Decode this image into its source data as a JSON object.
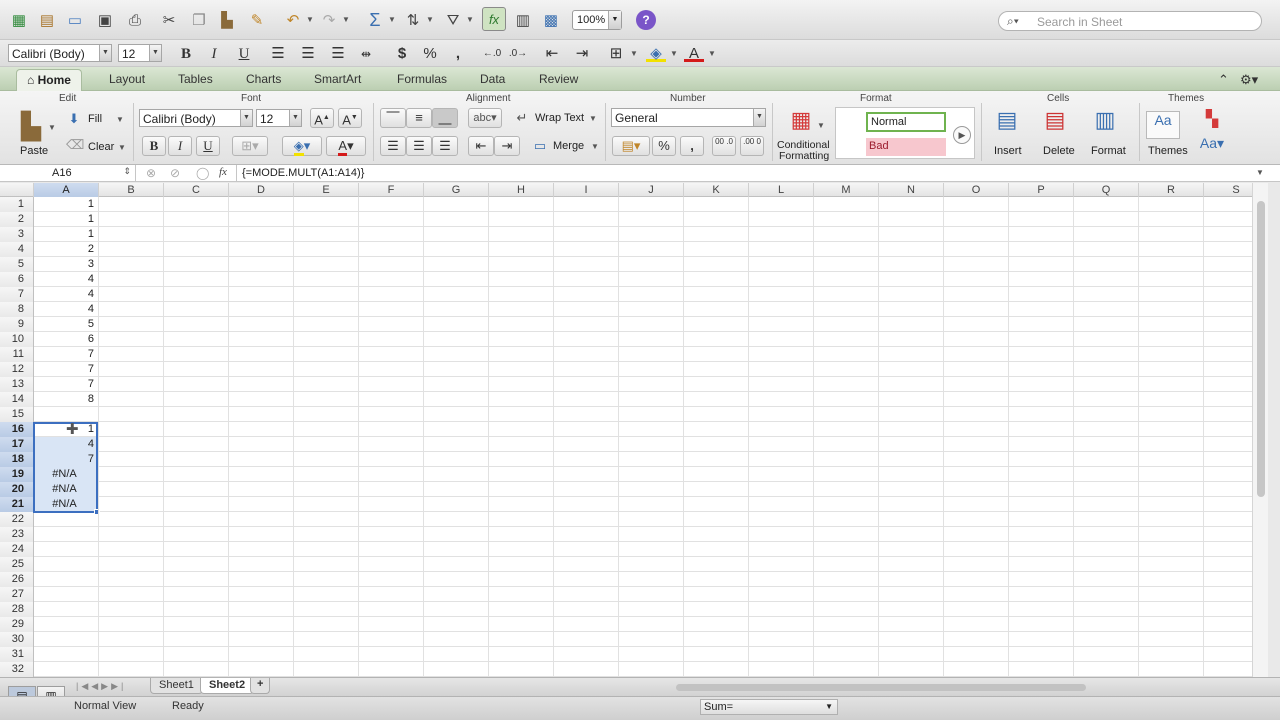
{
  "toolbar": {
    "zoom": "100%",
    "search_placeholder": "Search in Sheet"
  },
  "format_bar": {
    "font_name": "Calibri (Body)",
    "font_size": "12"
  },
  "tabs": [
    "Home",
    "Layout",
    "Tables",
    "Charts",
    "SmartArt",
    "Formulas",
    "Data",
    "Review"
  ],
  "ribbon": {
    "edit": {
      "title": "Edit",
      "paste": "Paste",
      "fill": "Fill",
      "clear": "Clear"
    },
    "font": {
      "title": "Font",
      "name": "Calibri (Body)",
      "size": "12"
    },
    "alignment": {
      "title": "Alignment",
      "wrap": "Wrap Text",
      "merge": "Merge",
      "abc": "abc"
    },
    "number": {
      "title": "Number",
      "format": "General",
      "dec_inc": "00 .0",
      "dec_dec": ".00 0"
    },
    "format": {
      "title": "Format",
      "conditional_l1": "Conditional",
      "conditional_l2": "Formatting",
      "style_normal": "Normal",
      "style_bad": "Bad"
    },
    "cells": {
      "title": "Cells",
      "insert": "Insert",
      "delete": "Delete",
      "format": "Format"
    },
    "themes": {
      "title": "Themes",
      "themes": "Themes",
      "aa": "Aa"
    }
  },
  "formula_bar": {
    "cell_ref": "A16",
    "fx": "fx",
    "formula": "{=MODE.MULT(A1:A14)}"
  },
  "grid": {
    "columns": [
      "A",
      "B",
      "C",
      "D",
      "E",
      "F",
      "G",
      "H",
      "I",
      "J",
      "K",
      "L",
      "M",
      "N",
      "O",
      "P",
      "Q",
      "R",
      "S"
    ],
    "rows": [
      {
        "n": "1",
        "a": "1"
      },
      {
        "n": "2",
        "a": "1"
      },
      {
        "n": "3",
        "a": "1"
      },
      {
        "n": "4",
        "a": "2"
      },
      {
        "n": "5",
        "a": "3"
      },
      {
        "n": "6",
        "a": "4"
      },
      {
        "n": "7",
        "a": "4"
      },
      {
        "n": "8",
        "a": "4"
      },
      {
        "n": "9",
        "a": "5"
      },
      {
        "n": "10",
        "a": "6"
      },
      {
        "n": "11",
        "a": "7"
      },
      {
        "n": "12",
        "a": "7"
      },
      {
        "n": "13",
        "a": "7"
      },
      {
        "n": "14",
        "a": "8"
      },
      {
        "n": "15",
        "a": ""
      },
      {
        "n": "16",
        "a": "1"
      },
      {
        "n": "17",
        "a": "4"
      },
      {
        "n": "18",
        "a": "7"
      },
      {
        "n": "19",
        "a": "#N/A"
      },
      {
        "n": "20",
        "a": "#N/A"
      },
      {
        "n": "21",
        "a": "#N/A"
      },
      {
        "n": "22",
        "a": ""
      },
      {
        "n": "23",
        "a": ""
      },
      {
        "n": "24",
        "a": ""
      },
      {
        "n": "25",
        "a": ""
      },
      {
        "n": "26",
        "a": ""
      },
      {
        "n": "27",
        "a": ""
      },
      {
        "n": "28",
        "a": ""
      },
      {
        "n": "29",
        "a": ""
      },
      {
        "n": "30",
        "a": ""
      },
      {
        "n": "31",
        "a": ""
      },
      {
        "n": "32",
        "a": ""
      }
    ]
  },
  "sheets": [
    "Sheet1",
    "Sheet2"
  ],
  "status": {
    "view": "Normal View",
    "ready": "Ready",
    "sum": "Sum="
  }
}
